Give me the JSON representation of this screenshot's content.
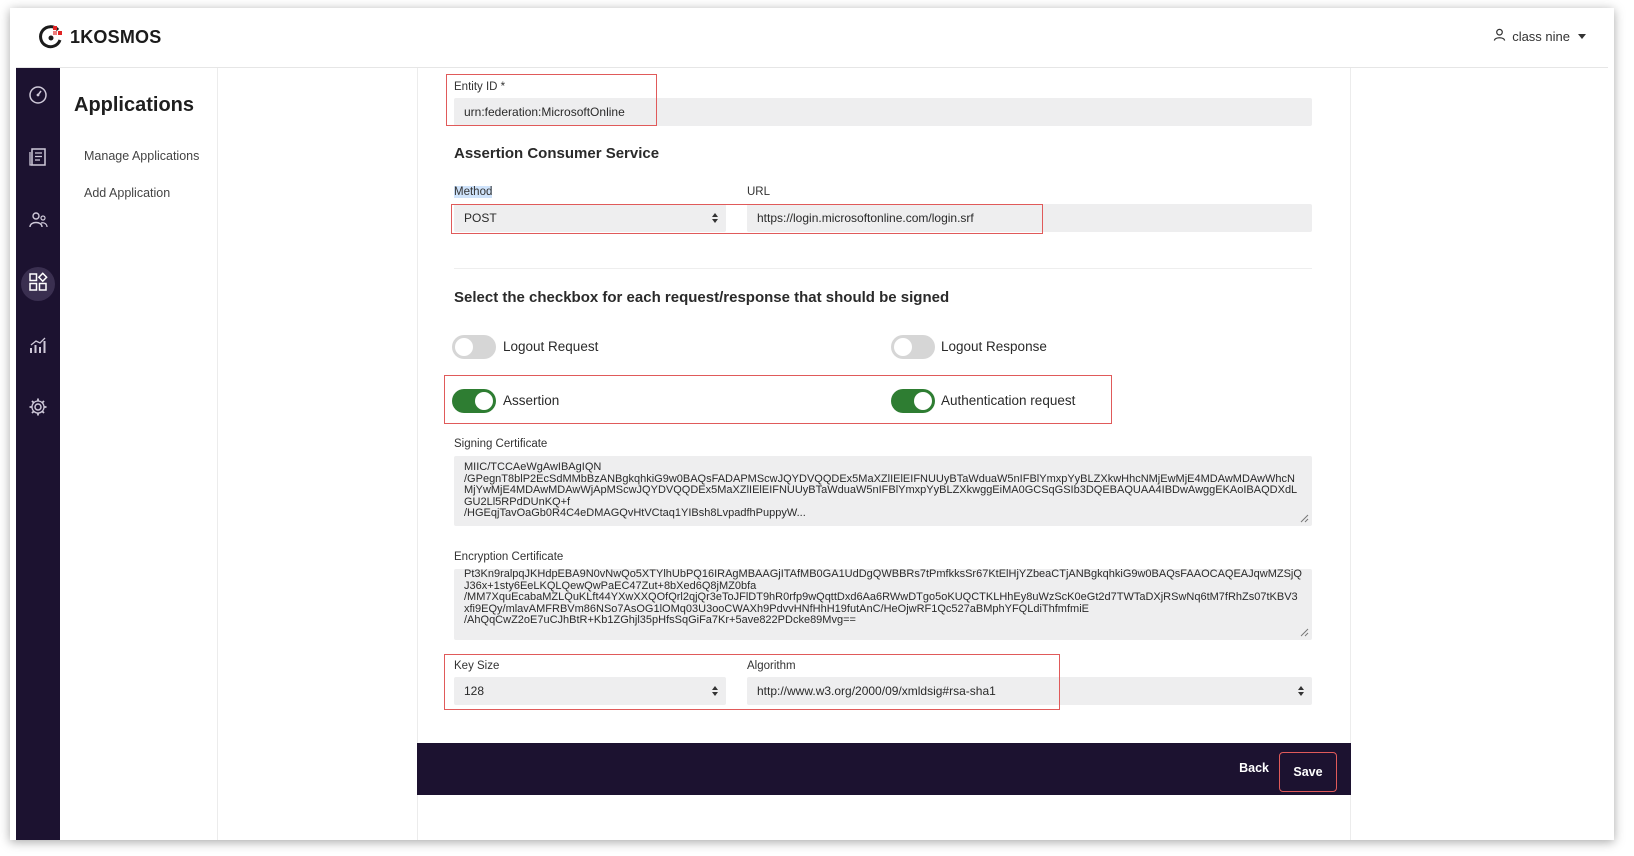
{
  "brand": {
    "name": "1KOSMOS",
    "logo_color": "#e02424"
  },
  "user": {
    "name": "class nine"
  },
  "rail": {
    "items": [
      {
        "icon": "dashboard-icon"
      },
      {
        "icon": "directory-icon"
      },
      {
        "icon": "users-icon"
      },
      {
        "icon": "applications-icon",
        "active": true
      },
      {
        "icon": "analytics-icon"
      },
      {
        "icon": "settings-icon"
      }
    ]
  },
  "subnav": {
    "title": "Applications",
    "items": [
      "Manage Applications",
      "Add Application"
    ]
  },
  "form": {
    "entity_id": {
      "label": "Entity ID *",
      "value": "urn:federation:MicrosoftOnline"
    },
    "acs": {
      "heading": "Assertion Consumer Service",
      "method_label": "Method",
      "method_value": "POST",
      "url_label": "URL",
      "url_value": "https://login.microsoftonline.com/login.srf"
    },
    "signing": {
      "heading": "Select the checkbox for each request/response that should be signed",
      "toggles": [
        {
          "label": "Logout Request",
          "on": false
        },
        {
          "label": "Logout Response",
          "on": false
        },
        {
          "label": "Assertion",
          "on": true
        },
        {
          "label": "Authentication request",
          "on": true
        }
      ]
    },
    "signing_certificate": {
      "label": "Signing Certificate",
      "value": "MIIC/TCCAeWgAwIBAgIQN\n/GPegnT8blP2EcSdMMbBzANBgkqhkiG9w0BAQsFADAPMScwJQYDVQQDEx5MaXZlIElEIFNUUyBTaWduaW5nIFBlYmxpYyBLZXkwHhcNMjEwMjE4MDAwMDAwWhcNMjYwMjE4MDAwMDAwWjApMScwJQYDVQQDEx5MaXZlIElEIFNUUyBTaWduaW5nIFBlYmxpYyBLZXkwggEiMA0GCSqGSIb3DQEBAQUAA4IBDwAwggEKAoIBAQDXdLGU2Ll5RPdDUnKQ+f\n/HGEqjTavOaGb0R4C4eDMAGQvHtVCtaq1YIBsh8LvpadfhPuppyW..."
    },
    "encryption_certificate": {
      "label": "Encryption Certificate",
      "value": "Pt3Kn9ralpqJKHdpEBA9N0vNwQo5XTYlhUbPQ16IRAgMBAAGjITAfMB0GA1UdDgQWBBRs7tPmfkksSr67KtElHjYZbeaCTjANBgkqhkiG9w0BAQsFAAOCAQEAJqwMZSjQJ36x+1sty6EeLKQLQewQwPaEC47Zut+8bXed6Q8jMZ0bfa\n/MM7XquEcabaMZLQuKLft44YXwXXQOfQrl2qjQr3eToJFlDT9hR0rfp9wQqttDxd6Aa6RWwDTgo5oKUQCTKLHhEy8uWzScK0eGt2d7TWTaDXjRSwNq6tM7fRhZs07tKBV3xfi9EQy/mlavAMFRBVm86NSo7AsOG1lOMq03U3ooCWAXh9PdvvHNfHhH19futAnC/HeOjwRF1Qc527aBMphYFQLdiThfmfmiE\n/AhQqCwZ2oE7uCJhBtR+Kb1ZGhjl35pHfsSqGiFa7Kr+5ave822PDcke89Mvg=="
    },
    "key_size": {
      "label": "Key Size",
      "value": "128"
    },
    "algorithm": {
      "label": "Algorithm",
      "value": "http://www.w3.org/2000/09/xmldsig#rsa-sha1"
    }
  },
  "footer": {
    "back_label": "Back",
    "save_label": "Save"
  },
  "colors": {
    "rail": "#1c1230",
    "toggle_on": "#2e7d32",
    "highlight": "#e05a5a"
  }
}
